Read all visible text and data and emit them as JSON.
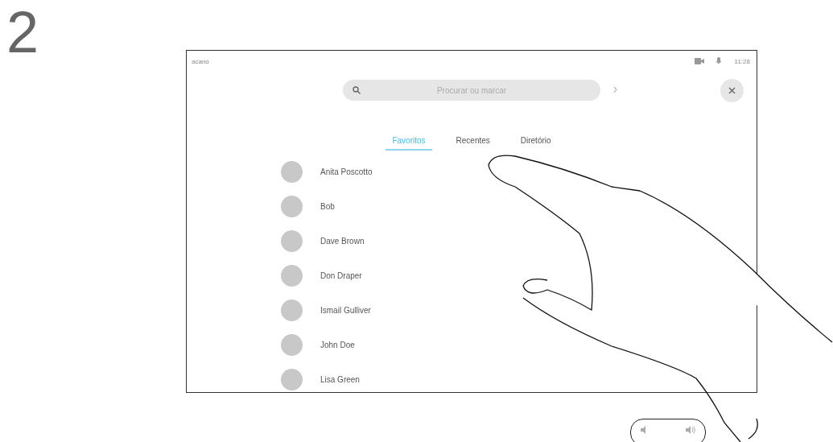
{
  "step": "2",
  "top_bar": {
    "label": "acano",
    "time": "11:28"
  },
  "search": {
    "placeholder": "Procurar ou marcar"
  },
  "tabs": [
    {
      "label": "Favoritos",
      "selected": true
    },
    {
      "label": "Recentes",
      "selected": false
    },
    {
      "label": "Diretório",
      "selected": false
    }
  ],
  "contacts": [
    {
      "name": "Anita Poscotto"
    },
    {
      "name": "Bob"
    },
    {
      "name": "Dave Brown"
    },
    {
      "name": "Don Draper"
    },
    {
      "name": "Ismail Gulliver"
    },
    {
      "name": "John Doe"
    },
    {
      "name": "Lisa Green"
    }
  ]
}
